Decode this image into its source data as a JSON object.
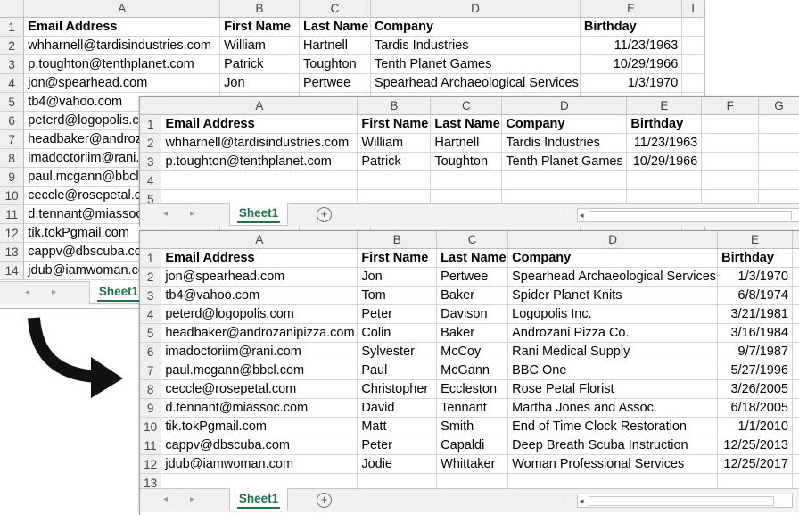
{
  "columns": {
    "s1": [
      "A",
      "B",
      "C",
      "D",
      "E",
      "I"
    ],
    "s2": [
      "A",
      "B",
      "C",
      "D",
      "E",
      "F",
      "G"
    ],
    "s3": [
      "A",
      "B",
      "C",
      "D",
      "E"
    ]
  },
  "headers": {
    "email": "Email Address",
    "first": "First Name",
    "last": "Last Name",
    "company": "Company",
    "birthday": "Birthday"
  },
  "source_rows": [
    {
      "email": "whharnell@tardisindustries.com",
      "first": "William",
      "last": "Hartnell",
      "company": "Tardis Industries",
      "birthday": "11/23/1963"
    },
    {
      "email": "p.toughton@tenthplanet.com",
      "first": "Patrick",
      "last": "Toughton",
      "company": "Tenth Planet Games",
      "birthday": "10/29/1966"
    },
    {
      "email": "jon@spearhead.com",
      "first": "Jon",
      "last": "Pertwee",
      "company": "Spearhead Archaeological Services",
      "birthday": "1/3/1970"
    },
    {
      "email": "tb4@vahoo.com"
    },
    {
      "email": "peterd@logopolis.cc"
    },
    {
      "email": "headbaker@androz"
    },
    {
      "email": "imadoctoriim@rani."
    },
    {
      "email": "paul.mcgann@bbcl."
    },
    {
      "email": "ceccle@rosepetal.c"
    },
    {
      "email": "d.tennant@miassoc"
    },
    {
      "email": "tik.tokPgmail.com"
    },
    {
      "email": "cappv@dbscuba.co"
    },
    {
      "email": "jdub@iamwoman.co"
    }
  ],
  "sheet2_rows": [
    {
      "email": "whharnell@tardisindustries.com",
      "first": "William",
      "last": "Hartnell",
      "company": "Tardis Industries",
      "birthday": "11/23/1963"
    },
    {
      "email": "p.toughton@tenthplanet.com",
      "first": "Patrick",
      "last": "Toughton",
      "company": "Tenth Planet Games",
      "birthday": "10/29/1966"
    }
  ],
  "sheet3_rows": [
    {
      "email": "jon@spearhead.com",
      "first": "Jon",
      "last": "Pertwee",
      "company": "Spearhead Archaeological Services",
      "birthday": "1/3/1970"
    },
    {
      "email": "tb4@vahoo.com",
      "first": "Tom",
      "last": "Baker",
      "company": "Spider Planet Knits",
      "birthday": "6/8/1974"
    },
    {
      "email": "peterd@logopolis.com",
      "first": "Peter",
      "last": "Davison",
      "company": "Logopolis Inc.",
      "birthday": "3/21/1981"
    },
    {
      "email": "headbaker@androzanipizza.com",
      "first": "Colin",
      "last": "Baker",
      "company": "Androzani Pizza Co.",
      "birthday": "3/16/1984"
    },
    {
      "email": "imadoctoriim@rani.com",
      "first": "Sylvester",
      "last": "McCoy",
      "company": "Rani Medical Supply",
      "birthday": "9/7/1987"
    },
    {
      "email": "paul.mcgann@bbcl.com",
      "first": "Paul",
      "last": "McGann",
      "company": "BBC One",
      "birthday": "5/27/1996"
    },
    {
      "email": "ceccle@rosepetal.com",
      "first": "Christopher",
      "last": "Eccleston",
      "company": "Rose Petal Florist",
      "birthday": "3/26/2005"
    },
    {
      "email": "d.tennant@miassoc.com",
      "first": "David",
      "last": "Tennant",
      "company": "Martha Jones and Assoc.",
      "birthday": "6/18/2005"
    },
    {
      "email": "tik.tokPgmail.com",
      "first": "Matt",
      "last": "Smith",
      "company": "End of Time Clock Restoration",
      "birthday": "1/1/2010"
    },
    {
      "email": "cappv@dbscuba.com",
      "first": "Peter",
      "last": "Capaldi",
      "company": "Deep Breath Scuba Instruction",
      "birthday": "12/25/2013"
    },
    {
      "email": "jdub@iamwoman.com",
      "first": "Jodie",
      "last": "Whittaker",
      "company": "Woman Professional Services",
      "birthday": "12/25/2017"
    }
  ],
  "tabs": {
    "sheet1": "Sheet1",
    "add_sheet_symbol": "+",
    "nav_prev": "◂",
    "nav_next": "▸",
    "menu_dots": "⋮"
  },
  "icons": {
    "transfer_arrow": "curved-arrow-icon"
  },
  "colors": {
    "tab_accent": "#217346",
    "header_bg": "#efefef",
    "gridline": "#d4d4d4"
  }
}
